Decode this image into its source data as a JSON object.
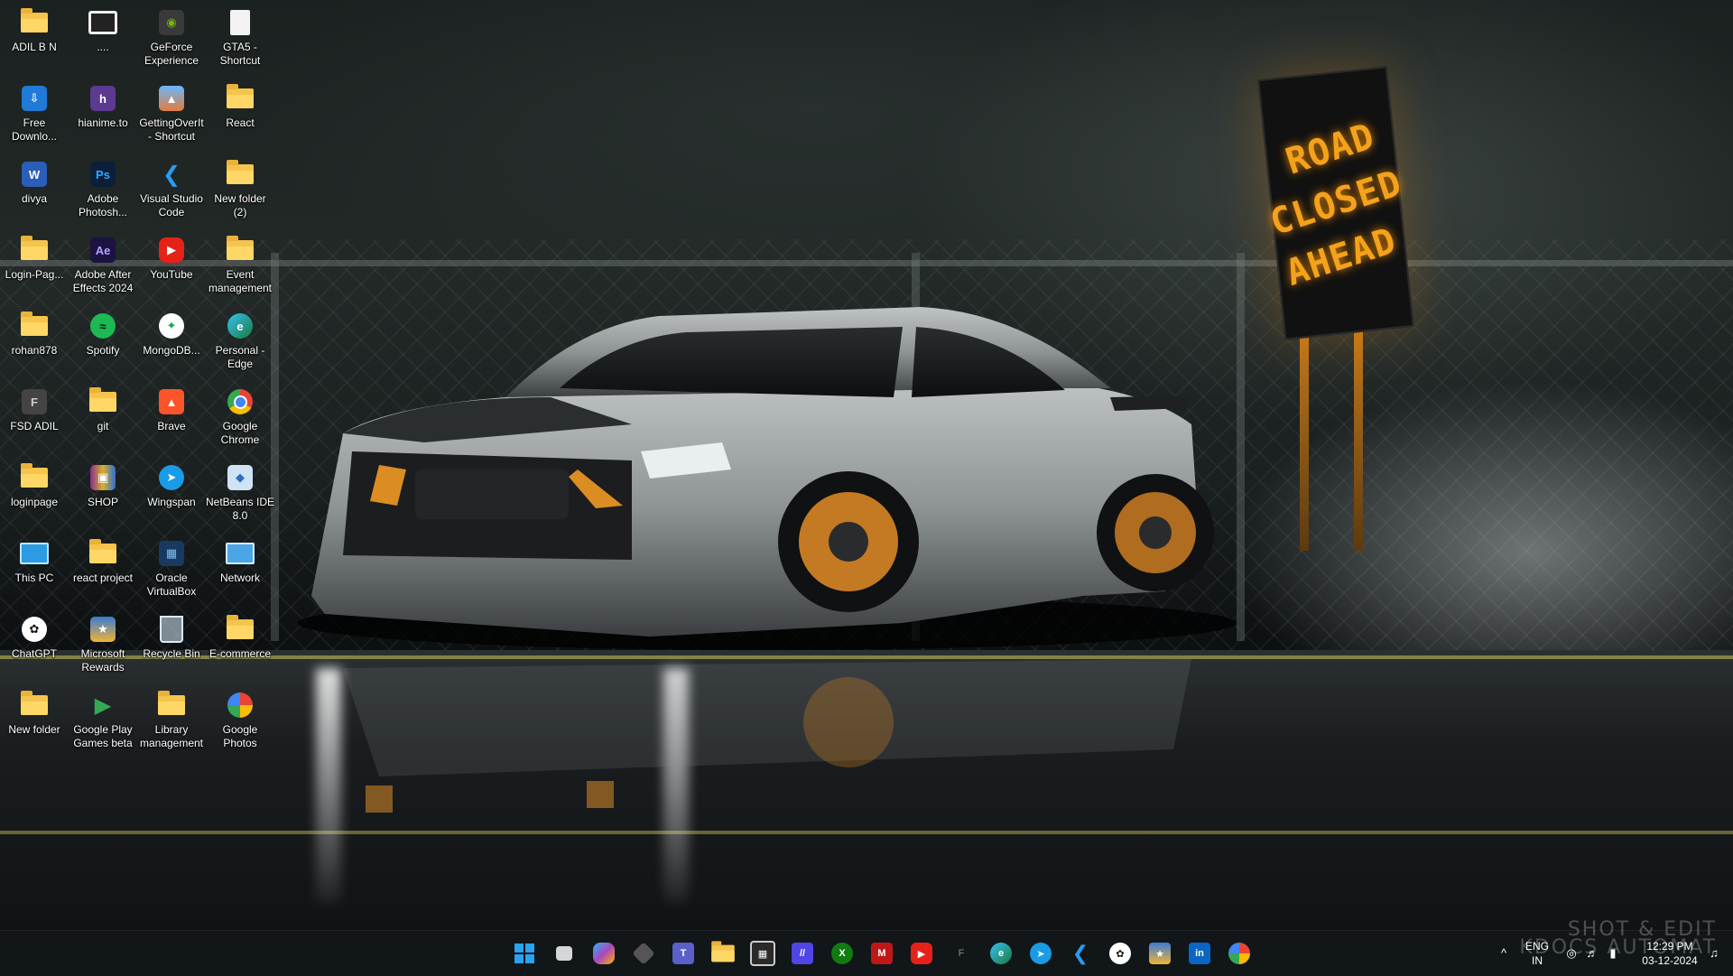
{
  "wallpaper": {
    "sign_lines": [
      "ROAD",
      "CLOSED",
      "AHEAD"
    ]
  },
  "desktop_icons": [
    {
      "label": "ADIL B N",
      "icon": "folder-icon"
    },
    {
      "label": "....",
      "icon": "monitor-icon"
    },
    {
      "label": "GeForce\nExperience",
      "icon": "geforce-icon"
    },
    {
      "label": "GTA5 -\nShortcut",
      "icon": "file-icon"
    },
    {
      "label": "Free\nDownlo...",
      "icon": "download-app-icon"
    },
    {
      "label": "hianime.to",
      "icon": "hianime-icon"
    },
    {
      "label": "GettingOverIt\n- Shortcut",
      "icon": "game-icon"
    },
    {
      "label": "React",
      "icon": "folder-icon"
    },
    {
      "label": "divya",
      "icon": "word-icon"
    },
    {
      "label": "Adobe\nPhotosh...",
      "icon": "photoshop-icon"
    },
    {
      "label": "Visual Studio\nCode",
      "icon": "vscode-icon"
    },
    {
      "label": "New folder\n(2)",
      "icon": "folder-icon"
    },
    {
      "label": "Login-Pag...",
      "icon": "folder-icon"
    },
    {
      "label": "Adobe After\nEffects 2024",
      "icon": "after-effects-icon"
    },
    {
      "label": "YouTube",
      "icon": "youtube-icon"
    },
    {
      "label": "Event\nmanagement",
      "icon": "folder-icon"
    },
    {
      "label": "rohan878",
      "icon": "folder-icon"
    },
    {
      "label": "Spotify",
      "icon": "spotify-icon"
    },
    {
      "label": "MongoDB...",
      "icon": "mongodb-icon"
    },
    {
      "label": "Personal -\nEdge",
      "icon": "edge-icon"
    },
    {
      "label": "FSD ADIL",
      "icon": "file-shortcut-icon"
    },
    {
      "label": "git",
      "icon": "folder-icon"
    },
    {
      "label": "Brave",
      "icon": "brave-icon"
    },
    {
      "label": "Google\nChrome",
      "icon": "chrome-icon"
    },
    {
      "label": "loginpage",
      "icon": "folder-icon"
    },
    {
      "label": "SHOP",
      "icon": "winrar-icon"
    },
    {
      "label": "Wingspan",
      "icon": "wingspan-icon"
    },
    {
      "label": "NetBeans IDE\n8.0",
      "icon": "netbeans-icon"
    },
    {
      "label": "This PC",
      "icon": "this-pc-icon"
    },
    {
      "label": "react project",
      "icon": "folder-icon"
    },
    {
      "label": "Oracle\nVirtualBox",
      "icon": "virtualbox-icon"
    },
    {
      "label": "Network",
      "icon": "network-icon"
    },
    {
      "label": "ChatGPT",
      "icon": "chatgpt-icon"
    },
    {
      "label": "Microsoft\nRewards",
      "icon": "rewards-icon"
    },
    {
      "label": "Recycle Bin",
      "icon": "recycle-bin-icon"
    },
    {
      "label": "E-commerce",
      "icon": "folder-icon"
    },
    {
      "label": "New folder",
      "icon": "folder-icon"
    },
    {
      "label": "Google Play\nGames beta",
      "icon": "play-games-icon"
    },
    {
      "label": "Library\nmanagement",
      "icon": "folder-icon"
    },
    {
      "label": "Google\nPhotos",
      "icon": "google-photos-icon"
    }
  ],
  "taskbar": {
    "pinned": [
      {
        "name": "start-icon"
      },
      {
        "name": "task-view-icon"
      },
      {
        "name": "copilot-icon"
      },
      {
        "name": "widgets-icon"
      },
      {
        "name": "teams-icon"
      },
      {
        "name": "file-explorer-icon"
      },
      {
        "name": "store-icon"
      },
      {
        "name": "notes-icon"
      },
      {
        "name": "xbox-icon"
      },
      {
        "name": "mcafee-icon"
      },
      {
        "name": "youtube-icon"
      },
      {
        "name": "fsd-shortcut-icon"
      },
      {
        "name": "edge-icon"
      },
      {
        "name": "wingspan-icon"
      },
      {
        "name": "vscode-icon"
      },
      {
        "name": "chatgpt-icon"
      },
      {
        "name": "rewards-icon"
      },
      {
        "name": "linkedin-icon"
      },
      {
        "name": "google-photos-icon"
      }
    ],
    "tray": {
      "lang_line1": "ENG",
      "lang_line2": "IN",
      "time": "12:29 PM",
      "date": "03-12-2024"
    }
  },
  "watermark": {
    "line1": "SHOT & EDIT",
    "line2": "KDOCS AUTOMAT"
  }
}
